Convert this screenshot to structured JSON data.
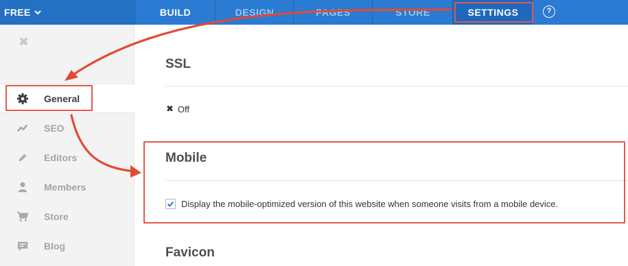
{
  "topbar": {
    "plan_label": "FREE",
    "tabs": [
      {
        "label": "BUILD"
      },
      {
        "label": "DESIGN"
      },
      {
        "label": "PAGES"
      },
      {
        "label": "STORE"
      },
      {
        "label": "SETTINGS"
      }
    ],
    "help_label": "?"
  },
  "sidebar": {
    "items": [
      {
        "label": "General",
        "icon": "gear-icon"
      },
      {
        "label": "SEO",
        "icon": "trend-icon"
      },
      {
        "label": "Editors",
        "icon": "pencil-icon"
      },
      {
        "label": "Members",
        "icon": "person-icon"
      },
      {
        "label": "Store",
        "icon": "cart-icon"
      },
      {
        "label": "Blog",
        "icon": "chat-icon"
      }
    ]
  },
  "main": {
    "ssl": {
      "title": "SSL",
      "status": "Off"
    },
    "mobile": {
      "title": "Mobile",
      "checkbox_label": "Display the mobile-optimized version of this website when someone visits from a mobile device.",
      "checked": true
    },
    "favicon": {
      "title": "Favicon"
    }
  },
  "colors": {
    "topbar": "#2a7bd1",
    "annotation": "#e4574a",
    "checkbox_check": "#2a7bd1"
  }
}
